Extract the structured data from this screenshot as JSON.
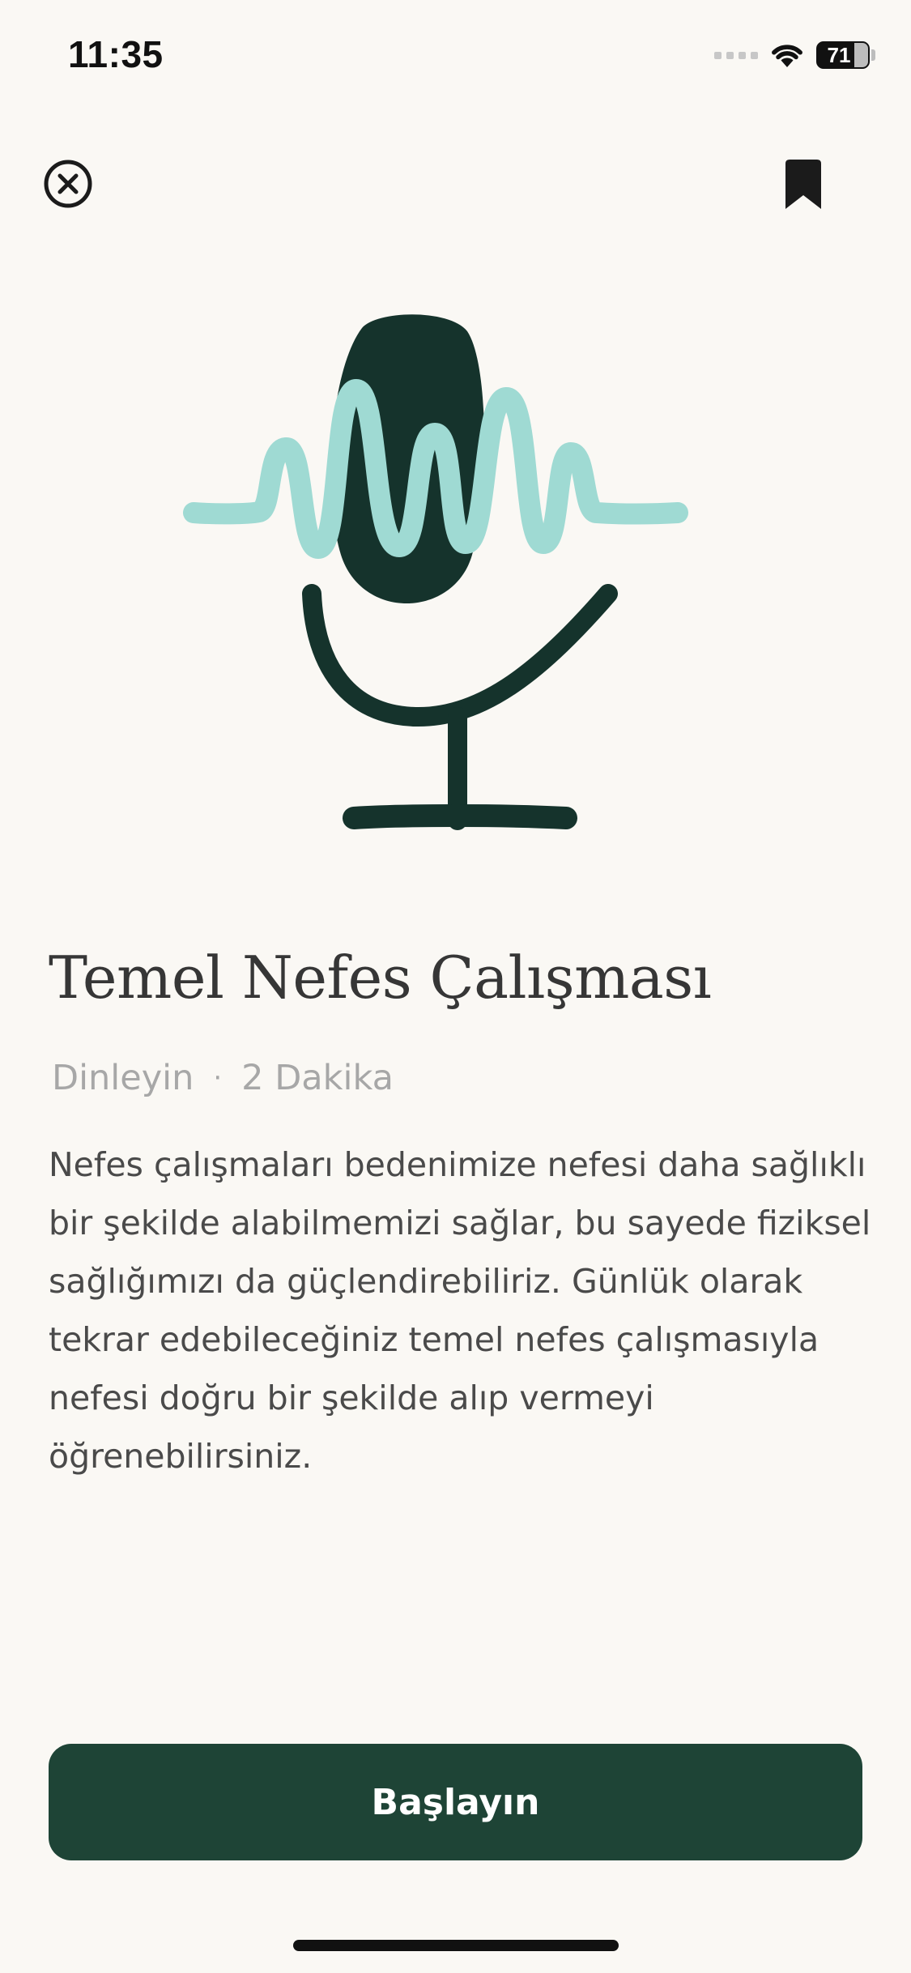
{
  "status_bar": {
    "time": "11:35",
    "battery": "71"
  },
  "header": {
    "close_icon": "close-circle-icon",
    "bookmark_icon": "bookmark-icon"
  },
  "illustration": {
    "icon": "microphone-with-sound-wave-illustration",
    "colors": {
      "mic": "#15332c",
      "wave": "#9fdad3"
    }
  },
  "content": {
    "title": "Temel Nefes Çalışması",
    "type": "Dinleyin",
    "separator": "·",
    "duration": "2 Dakika",
    "description": "Nefes çalışmaları bedenimize nefesi daha sağlıklı bir şekilde alabilmemizi sağlar, bu sayede fiziksel sağlığımızı da güçlendirebiliriz. Günlük olarak tekrar edebileceğiniz temel nefes çalışmasıyla nefesi doğru bir şekilde alıp vermeyi öğrenebilirsiniz."
  },
  "actions": {
    "start_label": "Başlayın"
  },
  "colors": {
    "background": "#faf8f4",
    "primary": "#1e4436",
    "text": "#363636",
    "muted": "#a7a7a7"
  }
}
